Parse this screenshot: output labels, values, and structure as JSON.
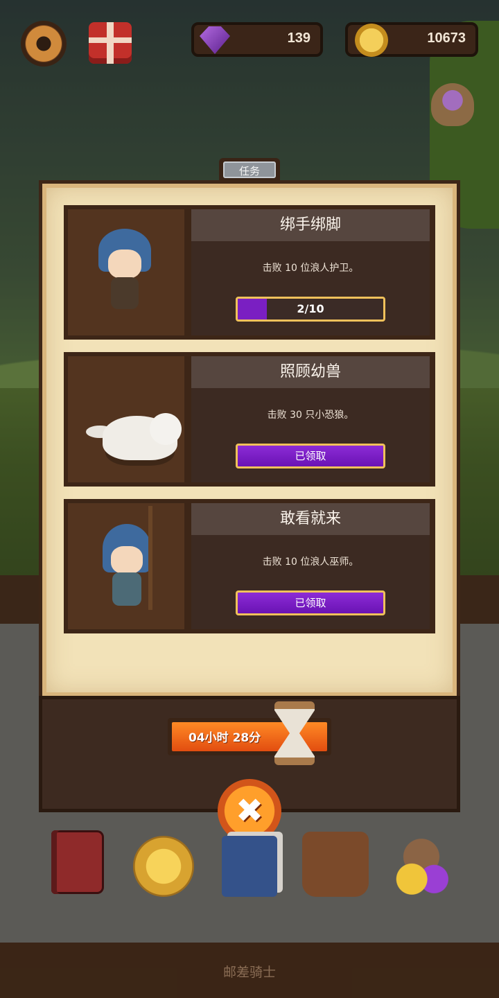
{
  "header": {
    "gems": "139",
    "coins": "10673"
  },
  "dialog": {
    "tab_label": "任务",
    "quests": [
      {
        "title": "绑手绑脚",
        "description": "击败 10 位浪人护卫。",
        "progress_text": "2/10",
        "progress_fraction": 0.2
      },
      {
        "title": "照顾幼兽",
        "description": "击败 30 只小恐狼。",
        "status_button": "已领取"
      },
      {
        "title": "敢看就来",
        "description": "击败 10 位浪人巫师。",
        "status_button": "已领取"
      }
    ],
    "timer_text": "04小时 28分",
    "close_symbol": "✖"
  },
  "footer": {
    "label": "邮差骑士"
  },
  "colors": {
    "panel_bg": "#f2e2b8",
    "card_border": "#3d2617",
    "progress_fill": "#7a1fc2",
    "button_border": "#f0c15b",
    "timer_fill": "#ff8a25"
  },
  "icons": [
    "settings-gear-icon",
    "gift-icon",
    "gem-icon",
    "coin-icon",
    "hourglass-icon",
    "close-icon",
    "spellbook-icon",
    "medal-icon",
    "cards-icon",
    "backpack-icon",
    "loot-icon"
  ]
}
